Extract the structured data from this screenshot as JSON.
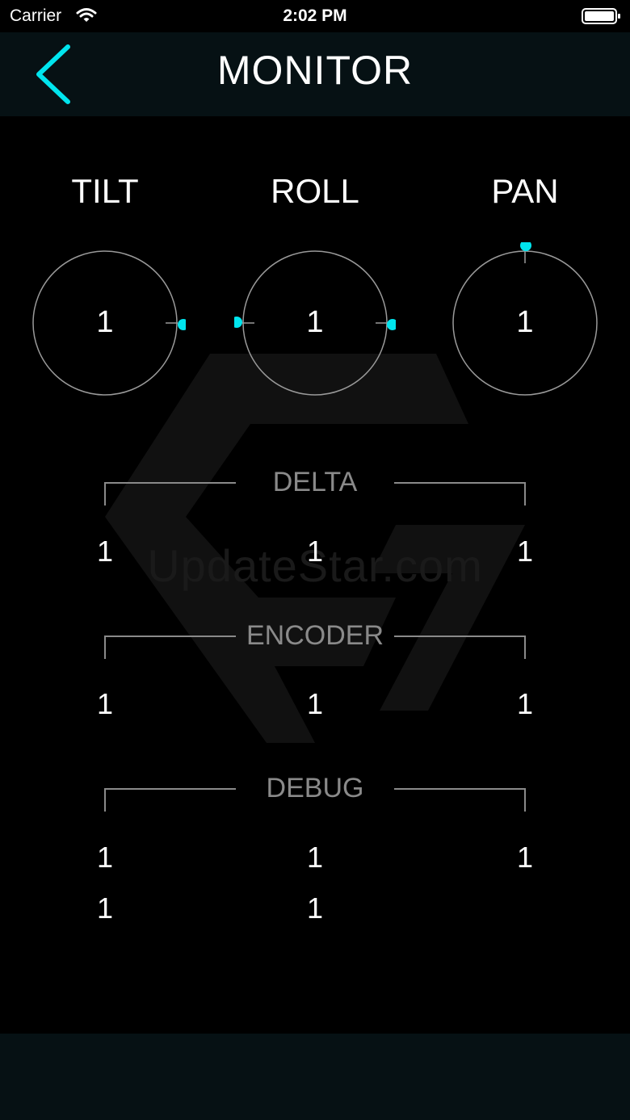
{
  "status_bar": {
    "carrier": "Carrier",
    "time": "2:02 PM",
    "wifi_icon": "wifi-icon",
    "battery_icon": "battery-icon"
  },
  "nav": {
    "title": "MONITOR",
    "back_icon": "chevron-left-icon"
  },
  "accent_color": "#00E5EE",
  "watermark": "UpdateStar.com",
  "dials": [
    {
      "label": "TILT",
      "value": "1"
    },
    {
      "label": "ROLL",
      "value": "1"
    },
    {
      "label": "PAN",
      "value": "1"
    }
  ],
  "delta": {
    "label": "DELTA",
    "values": [
      "1",
      "1",
      "1"
    ]
  },
  "encoder": {
    "label": "ENCODER",
    "values": [
      "1",
      "1",
      "1"
    ]
  },
  "debug": {
    "label": "DEBUG",
    "row1": [
      "1",
      "1",
      "1"
    ],
    "row2": [
      "1",
      "1"
    ]
  }
}
